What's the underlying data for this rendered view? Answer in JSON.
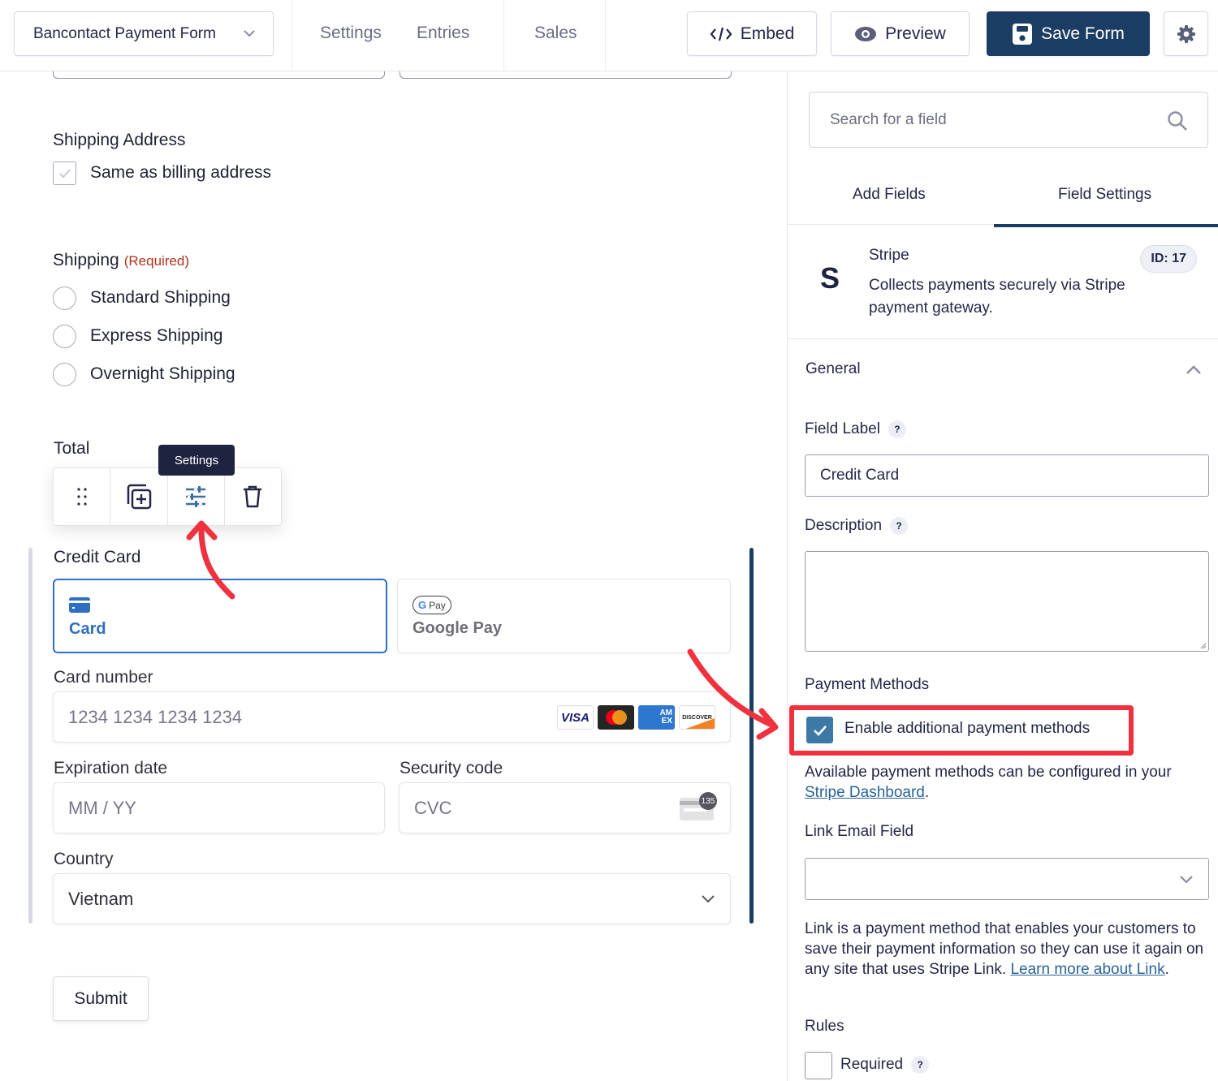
{
  "header": {
    "form_name": "Bancontact Payment Form",
    "nav": {
      "settings": "Settings",
      "entries": "Entries",
      "sales": "Sales"
    },
    "buttons": {
      "embed": "Embed",
      "preview": "Preview",
      "save": "Save Form"
    }
  },
  "canvas": {
    "shipping_address": {
      "label": "Shipping Address",
      "checkbox_label": "Same as billing address",
      "checked": true
    },
    "shipping": {
      "label": "Shipping",
      "required_tag": "(Required)",
      "options": [
        "Standard Shipping",
        "Express Shipping",
        "Overnight Shipping"
      ]
    },
    "total": {
      "label": "Total"
    },
    "toolbar": {
      "tooltip": "Settings"
    },
    "credit_card": {
      "label": "Credit Card",
      "tabs": {
        "card": "Card",
        "gpay_badge": "Pay",
        "gpay": "Google Pay"
      },
      "card_number_label": "Card number",
      "card_number_placeholder": "1234 1234 1234 1234",
      "brands": {
        "visa": "VISA",
        "amex_top": "AM",
        "amex_bottom": "EX",
        "discover": "DISCOVER"
      },
      "expiration_label": "Expiration date",
      "expiration_placeholder": "MM / YY",
      "security_label": "Security code",
      "security_placeholder": "CVC",
      "cvc_hint": "135",
      "country_label": "Country",
      "country_value": "Vietnam"
    },
    "submit": "Submit"
  },
  "sidebar": {
    "search_placeholder": "Search for a field",
    "tabs": {
      "add_fields": "Add Fields",
      "field_settings": "Field Settings"
    },
    "field": {
      "icon_letter": "S",
      "title": "Stripe",
      "description": "Collects payments securely via Stripe payment gateway.",
      "id_badge": "ID: 17"
    },
    "general": {
      "title": "General",
      "field_label_label": "Field Label",
      "field_label_value": "Credit Card",
      "description_label": "Description",
      "description_value": "",
      "payment_methods_label": "Payment Methods",
      "enable_additional_label": "Enable additional payment methods",
      "enable_additional_checked": true,
      "available_text": "Available payment methods can be configured in your ",
      "stripe_dashboard_link": "Stripe Dashboard",
      "period": ".",
      "link_email_label": "Link Email Field",
      "link_email_value": "",
      "link_text": "Link is a payment method that enables your customers to save their payment information so they can use it again on any site that uses Stripe Link. ",
      "learn_more_link": "Learn more about Link",
      "rules_label": "Rules",
      "required_label": "Required",
      "required_checked": false,
      "help_glyph": "?"
    }
  },
  "colors": {
    "primary": "#1c3d63",
    "card_accent": "#2f6fc1",
    "required": "#b0321e",
    "annotation": "#f0323e",
    "checkbox": "#3d79a6",
    "link": "#2a6496"
  }
}
